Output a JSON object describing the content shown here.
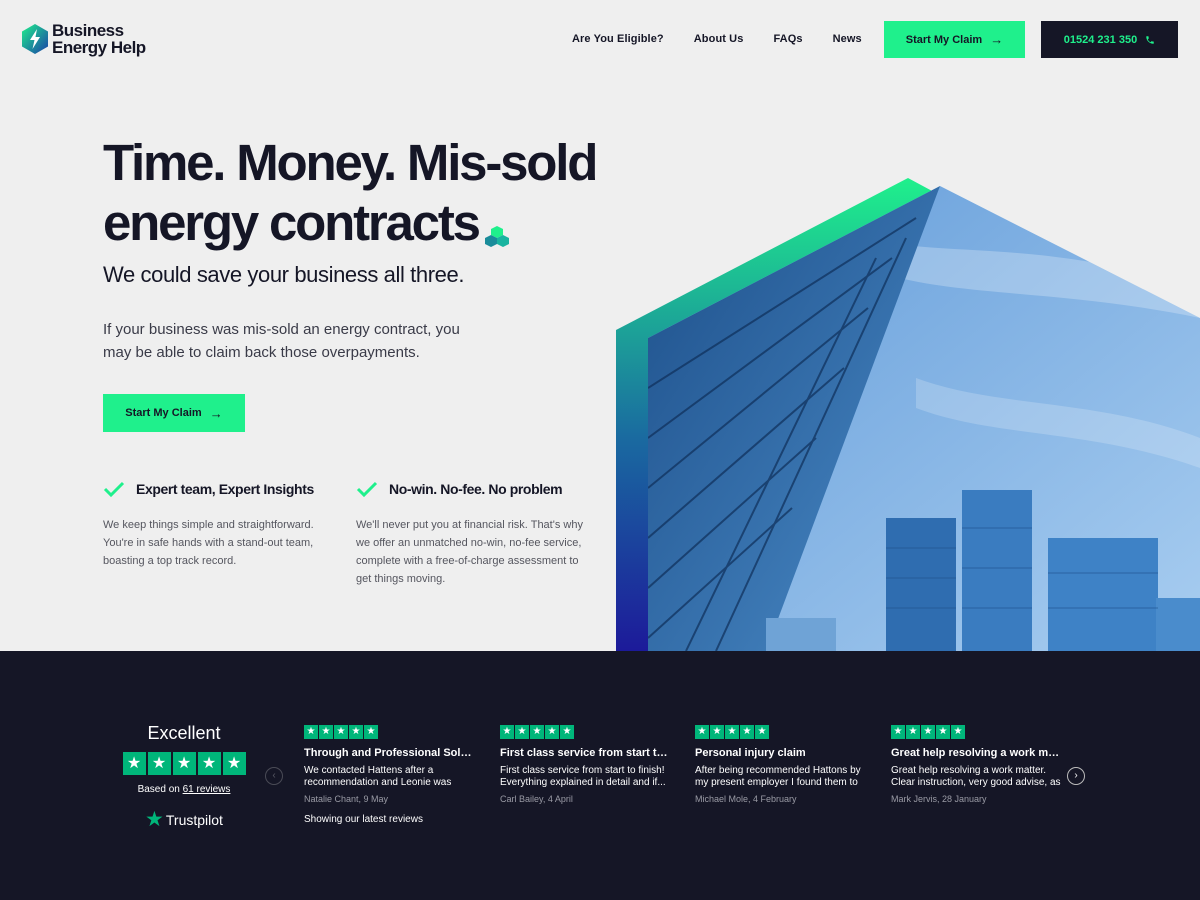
{
  "header": {
    "logo_line1": "Business",
    "logo_line2": "Energy Help",
    "nav": [
      "Are You Eligible?",
      "About Us",
      "FAQs",
      "News"
    ],
    "claim_button": "Start My Claim",
    "phone": "01524 231 350"
  },
  "hero": {
    "title_line1": "Time. Money. Mis-sold",
    "title_line2": "energy contracts",
    "subtitle": "We could save your business all three.",
    "body": "If your business was mis-sold an energy contract, you may be able to claim back those overpayments.",
    "cta": "Start My Claim"
  },
  "features": [
    {
      "title": "Expert team, Expert Insights",
      "text": "We keep things simple and straightforward. You're in safe hands with a stand-out team, boasting a top track record."
    },
    {
      "title": "No-win. No-fee. No problem",
      "text": "We'll never put you at financial risk. That's why we offer an unmatched no-win, no-fee service, complete with a free-of-charge assessment to get things moving."
    }
  ],
  "trustpilot": {
    "rating_word": "Excellent",
    "based_on": "Based on",
    "review_count": "61 reviews",
    "brand": "Trustpilot",
    "showing": "Showing our latest reviews",
    "stars": 5
  },
  "reviews": [
    {
      "title": "Through and Professional Solic...",
      "text": "We contacted Hattens after a recommendation and Leonie was",
      "author": "Natalie Chant, 9 May",
      "stars": 5
    },
    {
      "title": "First class service from start to...",
      "text": "First class service from start to finish! Everything explained in detail and if...",
      "author": "Carl Bailey, 4 April",
      "stars": 5
    },
    {
      "title": "Personal injury claim",
      "text": "After being recommended Hattons by my present employer I found them to",
      "author": "Michael Mole, 4 February",
      "stars": 5
    },
    {
      "title": "Great help resolving a work ma...",
      "text": "Great help resolving a work matter. Clear instruction, very good advise, as",
      "author": "Mark Jervis, 28 January",
      "stars": 5
    }
  ],
  "colors": {
    "accent": "#1ff08c",
    "dark": "#151626",
    "trustpilot": "#00b67a"
  },
  "icons": {
    "logo": "lightning-hexagon-icon",
    "arrow": "arrow-right-icon",
    "phone": "phone-icon",
    "check": "check-icon"
  }
}
